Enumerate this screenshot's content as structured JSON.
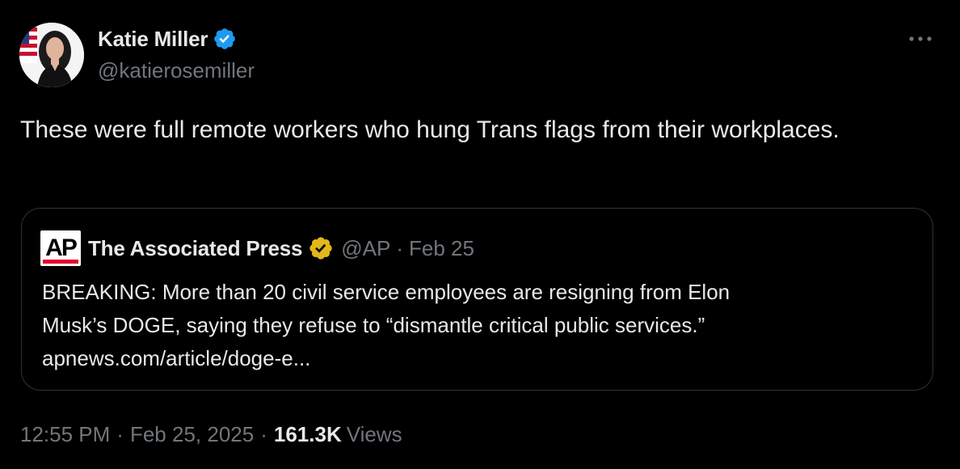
{
  "author": {
    "display_name": "Katie Miller",
    "handle": "@katierosemiller",
    "verified_badge": "blue-check-icon",
    "badge_color": "#1d9bf0"
  },
  "post": {
    "text": "These were full remote workers who hung Trans flags from their workplaces."
  },
  "quoted_post": {
    "logo": "AP",
    "display_name": "The Associated Press",
    "verified_badge": "gold-check-icon",
    "badge_color": "#e2b719",
    "handle": "@AP",
    "separator": "·",
    "date": "Feb 25",
    "text_line1": "BREAKING: More than 20 civil service employees are resigning from Elon",
    "text_line2": "Musk’s DOGE, saying they refuse to “dismantle critical public services.”",
    "link": "apnews.com/article/doge-e..."
  },
  "meta": {
    "time": "12:55 PM",
    "separator": "·",
    "date": "Feb 25, 2025",
    "views_count": "161.3K",
    "views_label": "Views"
  },
  "colors": {
    "background": "#000000",
    "primary_text": "#e7e9ea",
    "secondary_text": "#71767b",
    "border": "#2f3336"
  }
}
